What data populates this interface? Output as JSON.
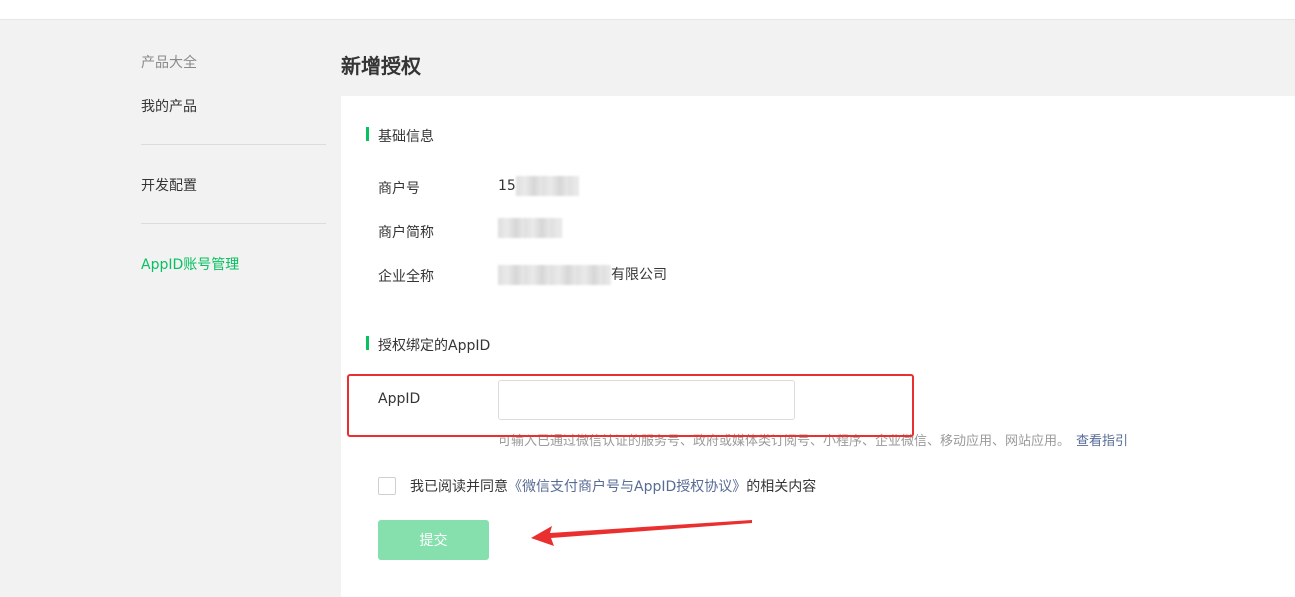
{
  "sidebar": {
    "group_title": "产品大全",
    "items": [
      {
        "label": "我的产品"
      },
      {
        "label": "开发配置"
      },
      {
        "label": "AppID账号管理"
      }
    ]
  },
  "page": {
    "title": "新增授权"
  },
  "basic_info": {
    "section_title": "基础信息",
    "merchant_id_label": "商户号",
    "merchant_id_value": "15",
    "merchant_short_label": "商户简称",
    "company_full_label": "企业全称",
    "company_full_suffix": "有限公司"
  },
  "appid_section": {
    "section_title": "授权绑定的AppID",
    "appid_label": "AppID",
    "appid_value": "",
    "hint": "可输入已通过微信认证的服务号、政府或媒体类订阅号、小程序、企业微信、移动应用、网站应用。",
    "guide_link": "查看指引"
  },
  "agreement": {
    "prefix": "我已阅读并同意",
    "link": "《微信支付商户号与AppID授权协议》",
    "suffix": "的相关内容",
    "checked": false
  },
  "submit": {
    "label": "提交"
  },
  "colors": {
    "accent": "#07c160",
    "link": "#576b95",
    "annotation": "#ea2f2f",
    "button_disabled": "#86e0ad"
  }
}
